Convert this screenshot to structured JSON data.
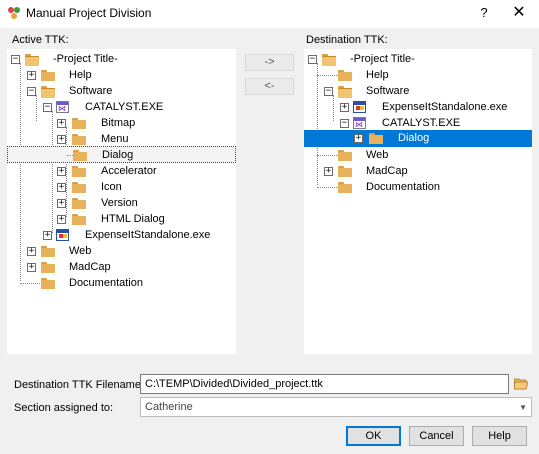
{
  "window": {
    "title": "Manual Project Division",
    "help": "?",
    "close": "✕"
  },
  "active": {
    "label": "Active TTK:",
    "nodes": {
      "root": "-Project Title-",
      "help": "Help",
      "software": "Software",
      "catalyst": "CATALYST.EXE",
      "bitmap": "Bitmap",
      "menu": "Menu",
      "dialog": "Dialog",
      "accelerator": "Accelerator",
      "icon": "Icon",
      "version": "Version",
      "html_dialog": "HTML Dialog",
      "expense": "ExpenseItStandalone.exe",
      "web": "Web",
      "madcap": "MadCap",
      "documentation": "Documentation"
    }
  },
  "destination": {
    "label": "Destination TTK:",
    "nodes": {
      "root": "-Project Title-",
      "help": "Help",
      "software": "Software",
      "expense": "ExpenseItStandalone.exe",
      "catalyst": "CATALYST.EXE",
      "dialog": "Dialog",
      "web": "Web",
      "madcap": "MadCap",
      "documentation": "Documentation"
    }
  },
  "move": {
    "right": "->",
    "left": "<-"
  },
  "form": {
    "filename_label": "Destination TTK Filename:",
    "filename_value": "C:\\TEMP\\Divided\\Divided_project.ttk",
    "section_label": "Section assigned to:",
    "section_value": "Catherine"
  },
  "buttons": {
    "ok": "OK",
    "cancel": "Cancel",
    "help": "Help"
  }
}
